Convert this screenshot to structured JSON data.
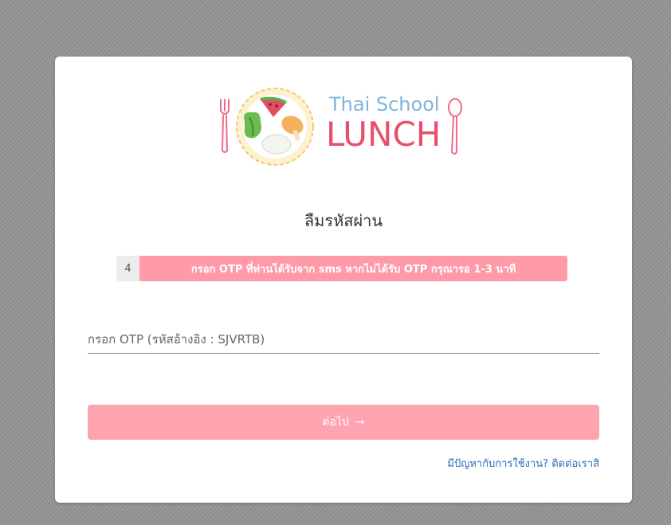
{
  "logo": {
    "line1": "Thai School",
    "line2": "LUNCH",
    "icon": "thai-school-lunch-logo"
  },
  "title": "ลืมรหัสผ่าน",
  "info": {
    "step": "4",
    "text": "กรอก OTP ที่ท่านได้รับจาก sms หากไม่ได้รับ OTP กรุณารอ 1-3 นาที"
  },
  "otp": {
    "placeholder": "กรอก OTP (รหัสอ้างอิง : SJVRTB)",
    "value": ""
  },
  "submit": {
    "label": "ต่อไป",
    "arrow": "→"
  },
  "help": {
    "label": "มีปัญหากับการใช้งาน? ติดต่อเราสิ"
  },
  "colors": {
    "background": "#8f8f8f",
    "accent_pink": "#fea4b0",
    "link_blue": "#2f6fb6",
    "logo_blue": "#7fb4dc",
    "logo_pink": "#e8506a"
  }
}
